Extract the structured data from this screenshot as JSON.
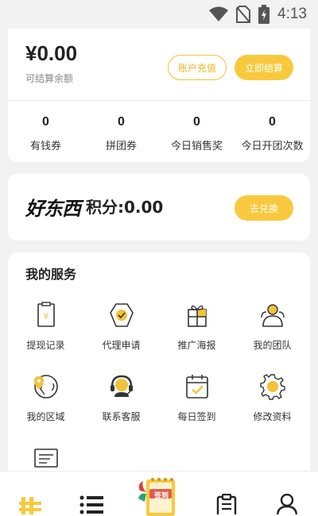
{
  "status_bar": {
    "time": "4:13"
  },
  "balance": {
    "amount": "¥0.00",
    "label": "可结算余额",
    "recharge_label": "账户充值",
    "settle_label": "立即结算"
  },
  "stats": [
    {
      "value": "0",
      "label": "有钱券"
    },
    {
      "value": "0",
      "label": "拼团券"
    },
    {
      "value": "0",
      "label": "今日销售奖"
    },
    {
      "value": "0",
      "label": "今日开团次数"
    }
  ],
  "points": {
    "logo_text": "好东西",
    "label": "积分:0.00",
    "exchange_label": "去兑换"
  },
  "services": {
    "title": "我的服务",
    "items": [
      {
        "label": "提现记录",
        "icon": "withdraw-record-icon"
      },
      {
        "label": "代理申请",
        "icon": "agent-apply-icon"
      },
      {
        "label": "推广海报",
        "icon": "gift-poster-icon"
      },
      {
        "label": "我的团队",
        "icon": "team-icon"
      },
      {
        "label": "我的区域",
        "icon": "region-globe-icon"
      },
      {
        "label": "联系客服",
        "icon": "customer-service-icon"
      },
      {
        "label": "每日签到",
        "icon": "calendar-checkin-icon"
      },
      {
        "label": "修改资料",
        "icon": "settings-gear-icon"
      },
      {
        "label": "",
        "icon": "document-list-icon"
      }
    ]
  },
  "tabbar": {
    "signin_badge": "签到"
  },
  "colors": {
    "accent": "#f8c93d",
    "accent_text": "#e8b92a",
    "background": "#f2f2f2"
  }
}
